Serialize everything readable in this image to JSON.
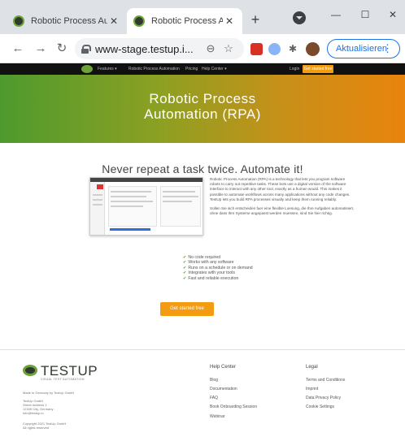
{
  "browser": {
    "tabs": [
      {
        "title": "Robotic Process Au",
        "active": false
      },
      {
        "title": "Robotic Process Au",
        "active": true
      }
    ],
    "new_tab_glyph": "+",
    "window_controls": {
      "minimize": "—",
      "maximize": "☐",
      "close": "✕"
    },
    "url": "www-stage.testup.i...",
    "update_button": "Aktualisieren",
    "icons": [
      "back-icon",
      "forward-icon",
      "reload-icon",
      "lock-icon",
      "zoom-icon",
      "star-icon",
      "puzzle-icon",
      "menu-icon"
    ]
  },
  "site": {
    "nav": {
      "items": [
        "Features ▾",
        "Robotic Process Automation",
        "Pricing",
        "Help Center ▾"
      ],
      "login": "Login",
      "cta": "Get started free"
    },
    "hero": {
      "line1": "Robotic Process",
      "line2": "Automation (RPA)"
    },
    "headline": "Never repeat a task twice. Automate it!",
    "description": [
      "Robotic Process Automation (RPA) is a technology that lets you program software robots to carry out repetitive tasks. These bots use a digital version of the software interface to interact with any other tool, exactly as a human would. This makes it possible to automate workflows across many applications without any code changes. TestUp lets you build RPA processes visually and keep them running reliably.",
      "Sollen Sie sich entscheiden fuer eine flexible Loesung, die Ihre Aufgaben automatisiert, ohne dass Ihre Systeme angepasst werden muessen, sind Sie hier richtig."
    ],
    "features": [
      "No code required",
      "Works with any software",
      "Runs on a schedule or on demand",
      "Integrates with your tools",
      "Fast and reliable execution"
    ],
    "cta_button": "Get started free",
    "footer": {
      "brand": "TESTUP",
      "tagline": "VISUAL TEST AUTOMATION",
      "contact_lines": [
        "Made in Germany by TestUp GmbH",
        "TestUp GmbH",
        "Street Address 1",
        "12345 City, Germany",
        "info@testup.io"
      ],
      "copyright_lines": [
        "Copyright 2021 TestUp GmbH",
        "All rights reserved"
      ],
      "col1_title": "Help Center",
      "col1_links": [
        "Blog",
        "Documentation",
        "FAQ",
        "Book Onboarding Session",
        "Webinar"
      ],
      "col2_title": "Legal",
      "col2_links": [
        "Terms and Conditions",
        "Imprint",
        "Data Privacy Policy",
        "Cookie Settings"
      ]
    }
  }
}
